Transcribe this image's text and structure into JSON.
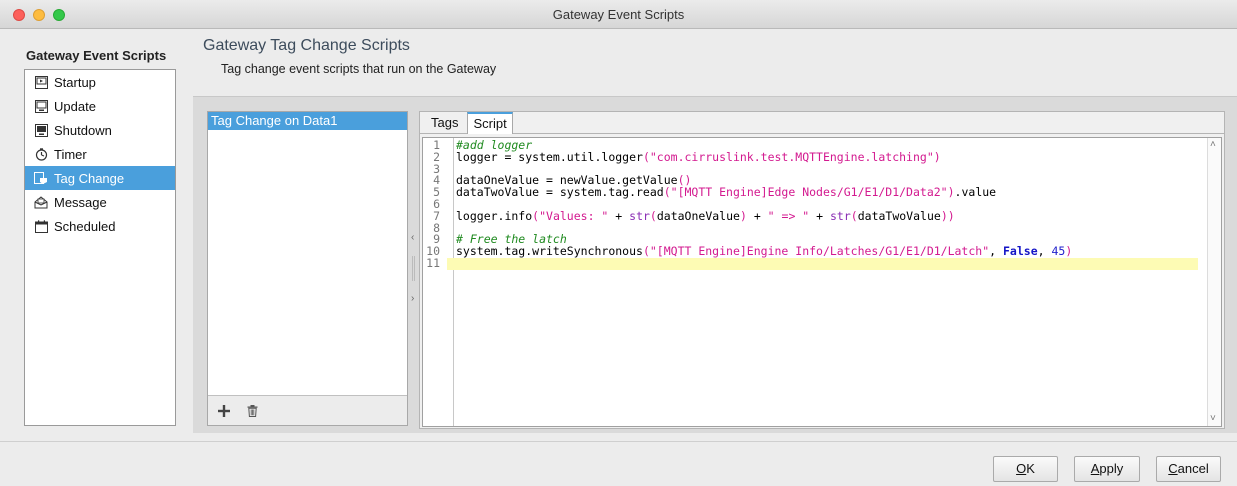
{
  "window": {
    "title": "Gateway Event Scripts"
  },
  "sidebar": {
    "title": "Gateway Event Scripts",
    "items": [
      {
        "label": "Startup",
        "icon": "startup-icon"
      },
      {
        "label": "Update",
        "icon": "update-icon"
      },
      {
        "label": "Shutdown",
        "icon": "shutdown-icon"
      },
      {
        "label": "Timer",
        "icon": "timer-icon"
      },
      {
        "label": "Tag Change",
        "icon": "tag-change-icon",
        "active": true
      },
      {
        "label": "Message",
        "icon": "message-icon"
      },
      {
        "label": "Scheduled",
        "icon": "calendar-icon"
      }
    ]
  },
  "header": {
    "title": "Gateway Tag Change Scripts",
    "subtitle": "Tag change event scripts that run on the Gateway"
  },
  "scripts": {
    "items": [
      "Tag Change on Data1"
    ],
    "add_icon": "plus-icon",
    "delete_icon": "trash-icon"
  },
  "editor": {
    "tabs": [
      "Tags",
      "Script"
    ],
    "active_tab": "Script",
    "current_line": 11,
    "line_numbers": [
      "1",
      "2",
      "3",
      "4",
      "5",
      "6",
      "7",
      "8",
      "9",
      "10",
      "11"
    ],
    "code_lines": [
      "#add logger",
      "logger = system.util.logger(\"com.cirruslink.test.MQTTEngine.latching\")",
      "",
      "dataOneValue = newValue.getValue()",
      "dataTwoValue = system.tag.read(\"[MQTT Engine]Edge Nodes/G1/E1/D1/Data2\").value",
      "",
      "logger.info(\"Values: \" + str(dataOneValue) + \" => \" + str(dataTwoValue))",
      "",
      "# Free the latch",
      "system.tag.writeSynchronous(\"[MQTT Engine]Engine Info/Latches/G1/E1/D1/Latch\", False, 45)",
      ""
    ]
  },
  "buttons": {
    "ok": {
      "mnemonic": "O",
      "rest": "K"
    },
    "apply": {
      "mnemonic": "A",
      "rest": "pply"
    },
    "cancel": {
      "mnemonic": "C",
      "rest": "ancel"
    }
  }
}
